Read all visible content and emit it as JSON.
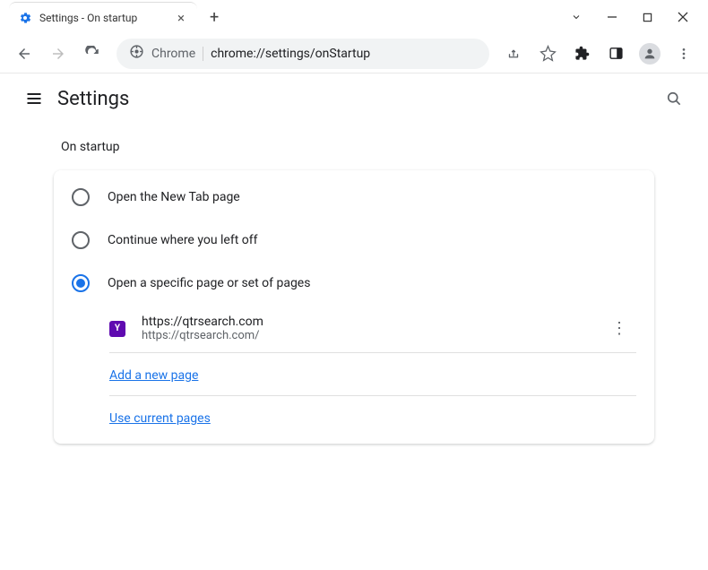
{
  "window": {
    "tab_title": "Settings - On startup"
  },
  "toolbar": {
    "url_host": "Chrome",
    "url_path": "chrome://settings/onStartup"
  },
  "header": {
    "title": "Settings"
  },
  "section": {
    "title": "On startup"
  },
  "options": {
    "new_tab": "Open the New Tab page",
    "continue": "Continue where you left off",
    "specific": "Open a specific page or set of pages"
  },
  "startup_page": {
    "title": "https://qtrsearch.com",
    "url": "https://qtrsearch.com/",
    "favicon_letter": "Y"
  },
  "links": {
    "add_page": "Add a new page",
    "use_current": "Use current pages"
  }
}
